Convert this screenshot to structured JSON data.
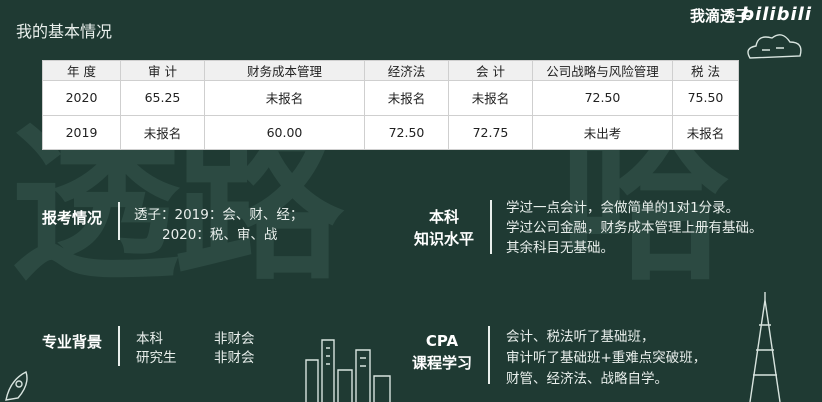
{
  "header": {
    "page_title": "我的基本情况",
    "brand": "我滴透子",
    "logo_text": "bilibili"
  },
  "background": {
    "glyph_left": "透路",
    "glyph_right": "哈"
  },
  "table": {
    "headers": [
      "年 度",
      "审 计",
      "财务成本管理",
      "经济法",
      "会 计",
      "公司战略与风险管理",
      "税 法"
    ],
    "rows": [
      [
        "2020",
        "65.25",
        "未报名",
        "未报名",
        "未报名",
        "72.50",
        "75.50"
      ],
      [
        "2019",
        "未报名",
        "60.00",
        "72.50",
        "72.75",
        "未出考",
        "未报名"
      ]
    ]
  },
  "enrollment": {
    "label": "报考情况",
    "lines": [
      "透子：2019：会、财、经；",
      "2020：税、审、战"
    ]
  },
  "undergrad": {
    "label_lines": [
      "本科",
      "知识水平"
    ],
    "lines": [
      "学过一点会计，会做简单的1对1分录。",
      "学过公司金融，财务成本管理上册有基础。",
      "其余科目无基础。"
    ]
  },
  "major": {
    "label": "专业背景",
    "rows": [
      [
        "本科",
        "非财会"
      ],
      [
        "研究生",
        "非财会"
      ]
    ]
  },
  "cpa": {
    "label_lines": [
      "CPA",
      "课程学习"
    ],
    "lines": [
      "会计、税法听了基础班，",
      "审计听了基础班+重难点突破班，",
      "财管、经济法、战略自学。"
    ]
  },
  "icons": [
    "cloud-doodle-icon",
    "city-skyline-icon",
    "rocket-doodle-icon",
    "radio-tower-icon"
  ]
}
